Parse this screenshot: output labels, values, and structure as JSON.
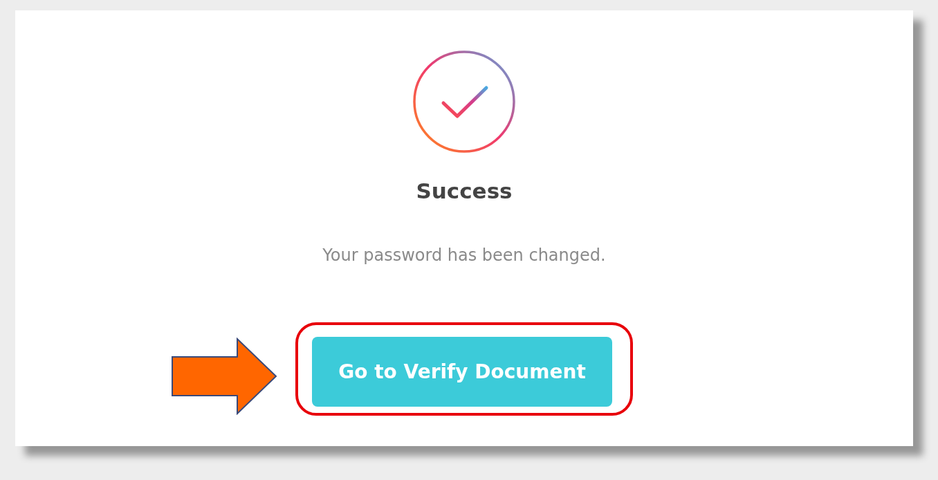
{
  "dialog": {
    "title": "Success",
    "message": "Your password has been changed.",
    "button": "Go to Verify Document"
  }
}
